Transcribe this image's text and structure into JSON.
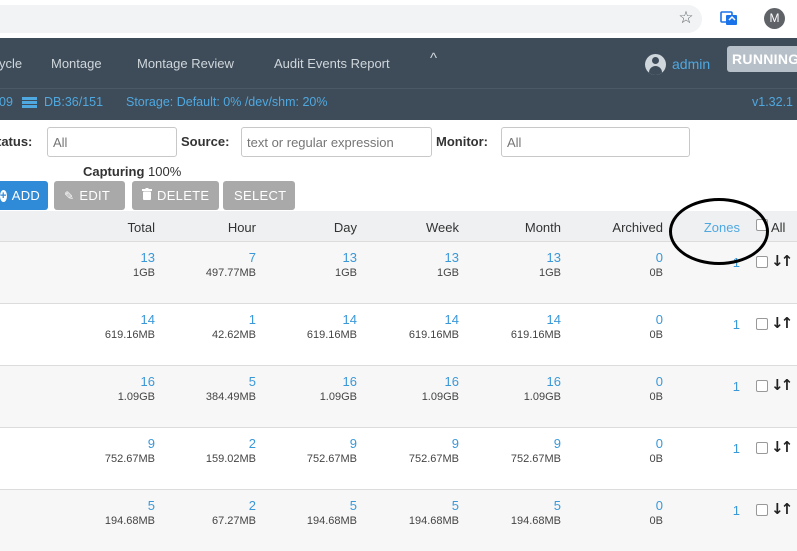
{
  "browser": {
    "avatar_letter": "M"
  },
  "nav": {
    "items": [
      "ycle",
      "Montage",
      "Montage Review",
      "Audit Events Report"
    ],
    "chevron": "^",
    "user": "admin",
    "state_button": "RUNNING"
  },
  "status": {
    "num": "09",
    "db": "DB:36/151",
    "storage": "Storage: Default: 0% /dev/shm: 20%",
    "version": "v1.32.1"
  },
  "filters": {
    "status_label": "tatus:",
    "status_placeholder": "All",
    "source_label": "Source:",
    "source_placeholder": "text or regular expression",
    "monitor_label": "Monitor:",
    "monitor_placeholder": "All"
  },
  "capturing": {
    "label": "Capturing",
    "value": "100%"
  },
  "actions": {
    "add": "ADD",
    "edit": "EDIT",
    "delete": "DELETE",
    "select": "SELECT"
  },
  "table": {
    "headers": {
      "total": "Total",
      "hour": "Hour",
      "day": "Day",
      "week": "Week",
      "month": "Month",
      "archived": "Archived",
      "zones": "Zones",
      "all": "All"
    },
    "rows": [
      {
        "total": [
          "13",
          "1GB"
        ],
        "hour": [
          "7",
          "497.77MB"
        ],
        "day": [
          "13",
          "1GB"
        ],
        "week": [
          "13",
          "1GB"
        ],
        "month": [
          "13",
          "1GB"
        ],
        "archived": [
          "0",
          "0B"
        ],
        "zones": "1"
      },
      {
        "total": [
          "14",
          "619.16MB"
        ],
        "hour": [
          "1",
          "42.62MB"
        ],
        "day": [
          "14",
          "619.16MB"
        ],
        "week": [
          "14",
          "619.16MB"
        ],
        "month": [
          "14",
          "619.16MB"
        ],
        "archived": [
          "0",
          "0B"
        ],
        "zones": "1"
      },
      {
        "total": [
          "16",
          "1.09GB"
        ],
        "hour": [
          "5",
          "384.49MB"
        ],
        "day": [
          "16",
          "1.09GB"
        ],
        "week": [
          "16",
          "1.09GB"
        ],
        "month": [
          "16",
          "1.09GB"
        ],
        "archived": [
          "0",
          "0B"
        ],
        "zones": "1"
      },
      {
        "total": [
          "9",
          "752.67MB"
        ],
        "hour": [
          "2",
          "159.02MB"
        ],
        "day": [
          "9",
          "752.67MB"
        ],
        "week": [
          "9",
          "752.67MB"
        ],
        "month": [
          "9",
          "752.67MB"
        ],
        "archived": [
          "0",
          "0B"
        ],
        "zones": "1"
      },
      {
        "total": [
          "5",
          "194.68MB"
        ],
        "hour": [
          "2",
          "67.27MB"
        ],
        "day": [
          "5",
          "194.68MB"
        ],
        "week": [
          "5",
          "194.68MB"
        ],
        "month": [
          "5",
          "194.68MB"
        ],
        "archived": [
          "0",
          "0B"
        ],
        "zones": "1"
      }
    ]
  },
  "icons": {
    "star": "star-icon",
    "extension": "extension-icon",
    "user": "user-icon",
    "database": "database-icon",
    "edit": "edit-icon",
    "trash": "trash-icon",
    "plus": "plus-icon",
    "sort": "sort-icon"
  },
  "colors": {
    "nav_bg": "#3e4c59",
    "link": "#3a98d8",
    "add_button": "#2f8ad8",
    "neutral_button": "#a9a9a9"
  }
}
